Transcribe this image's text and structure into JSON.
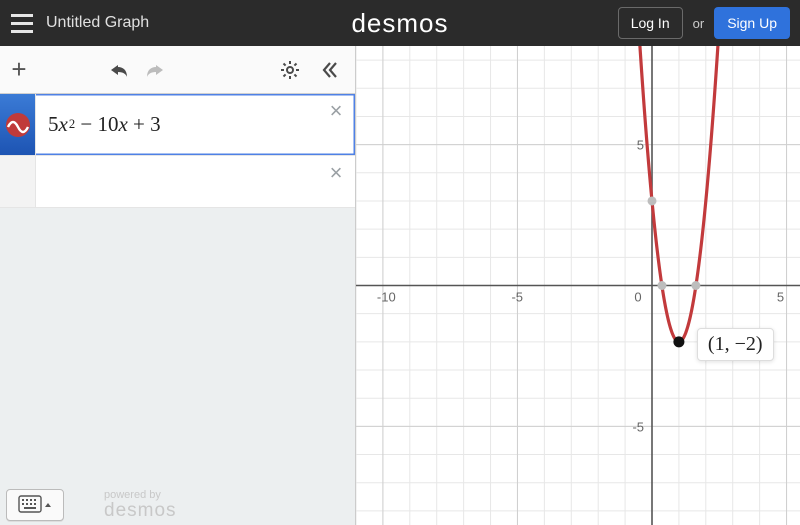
{
  "header": {
    "title": "Untitled Graph",
    "logo": "desmos",
    "login": "Log In",
    "or": "or",
    "signup": "Sign Up"
  },
  "panel": {
    "expression_display": "5x² − 10x + 3"
  },
  "footer": {
    "powered": "powered by",
    "brand": "desmos"
  },
  "graph": {
    "axis_ticks_x": [
      "-10",
      "-5",
      "0",
      "5"
    ],
    "axis_ticks_y": [
      "5",
      "-5"
    ],
    "vertex_label": "(1, −2)"
  },
  "chart_data": {
    "type": "line",
    "title": "",
    "xlabel": "",
    "ylabel": "",
    "xlim": [
      -11,
      5.5
    ],
    "ylim": [
      -8.5,
      8.5
    ],
    "series": [
      {
        "name": "5x^2 - 10x + 3",
        "x": [
          -0.5,
          -0.3,
          0,
          0.3,
          0.6,
          1,
          1.4,
          1.7,
          2,
          2.3,
          2.5
        ],
        "y": [
          9.25,
          6.45,
          3,
          0.45,
          -1.2,
          -2,
          -1.2,
          0.45,
          3,
          6.45,
          9.25
        ],
        "color": "#c23a3c"
      }
    ],
    "points": [
      {
        "name": "vertex",
        "x": 1,
        "y": -2,
        "label": "(1, -2)"
      },
      {
        "name": "y-intercept",
        "x": 0,
        "y": 3
      },
      {
        "name": "root-left",
        "x": 0.37,
        "y": 0
      },
      {
        "name": "root-right",
        "x": 1.63,
        "y": 0
      }
    ]
  }
}
